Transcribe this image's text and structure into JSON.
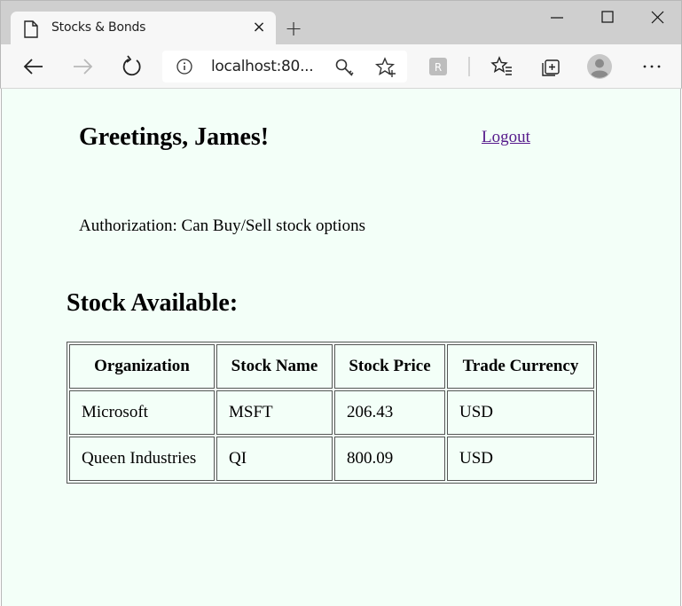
{
  "browser": {
    "tab_title": "Stocks & Bonds",
    "tab_close": "×",
    "new_tab": "+",
    "address": "localhost:80..."
  },
  "page": {
    "greeting": "Greetings, James!",
    "logout_label": "Logout",
    "authorization": "Authorization: Can Buy/Sell stock options",
    "stock_heading": "Stock Available:",
    "table": {
      "headers": [
        "Organization",
        "Stock Name",
        "Stock Price",
        "Trade Currency"
      ],
      "rows": [
        [
          "Microsoft",
          "MSFT",
          "206.43",
          "USD"
        ],
        [
          "Queen Industries",
          "QI",
          "800.09",
          "USD"
        ]
      ]
    }
  },
  "icons": {
    "tab": "page-icon",
    "minimize": "minimize-icon",
    "maximize": "maximize-icon",
    "close": "close-icon",
    "back": "back-arrow-icon",
    "forward": "forward-arrow-icon",
    "refresh": "refresh-icon",
    "info": "info-icon",
    "key": "key-icon",
    "favorite": "star-add-icon",
    "extension": "extension-icon",
    "favorites": "favorites-icon",
    "collections": "collections-icon",
    "profile": "profile-icon",
    "menu": "more-icon"
  },
  "colors": {
    "page_background": "#f3fff8",
    "visited_link": "#551a8b",
    "chrome": "#cfcfcf",
    "toolbar": "#f7f7f7"
  }
}
